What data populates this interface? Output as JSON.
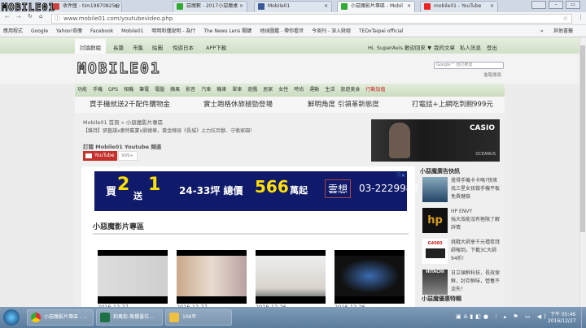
{
  "browser": {
    "tabs": [
      {
        "label": "收件匣 - tim19870825@",
        "color": "#c44"
      },
      {
        "label": "惡魔數 - 2017小惡魔桌",
        "color": "#3a3"
      },
      {
        "label": "Mobile01",
        "color": "#3b5998"
      },
      {
        "label": "小惡魔影片專區 - Mobil",
        "color": "#3a3",
        "active": true
      },
      {
        "label": "mobile01 - YouTube",
        "color": "#e22"
      }
    ],
    "url": "www.mobile01.com/youtubevideo.php",
    "bookmarks": [
      "應用程式",
      "Google",
      "Yahoo!奇摩",
      "Facebook",
      "Mobile01",
      "明明和僅說明 - 為什",
      "The News Lens 關鍵",
      "地球圖鑑 - 帶你看世",
      "今周刊 - 深入財經",
      "TEDxTaipei official",
      "»",
      "其他書籤"
    ]
  },
  "site": {
    "logo": "MOBILE01",
    "nav": [
      "討論群組",
      "長篇",
      "市集",
      "貼圖",
      "悅遊日本",
      "APP下載"
    ],
    "user": "Hi, SuperAvis 歡迎回來 ▼",
    "user_links": [
      "我的文章",
      "私人訊息",
      "登出"
    ],
    "search_placeholder": "Google™ 自訂搜尋",
    "adv_search": "進階搜尋",
    "categories": [
      "功能",
      "手機",
      "GPS",
      "相機",
      "筆電",
      "電腦",
      "蘋果",
      "影音",
      "汽車",
      "機車",
      "單車",
      "遊戲",
      "居家",
      "女性",
      "時尚",
      "運動",
      "生活",
      "旅遊美食",
      "行動加值"
    ],
    "promos": [
      "買手機就送2千配件購物金",
      "實士跑格休旅極勁登場",
      "鮮明角度 引領革新態度",
      "打電話+上網吃到飽999元"
    ],
    "breadcrumb": "Mobile01 首頁 » 小惡魔影片專區",
    "headline": "【雜詩】張藝謀x麥特戴蒙x劉德華，黃金陣容《長城》上力抗巨獸、守衛家園！",
    "subscribe_label": "訂閱 Mobile01 Youtube 頻道",
    "youtube_btn": "YouTube",
    "sub_count": "999+",
    "casio_ad": {
      "brand": "CASIO",
      "sub": "OCEANUS"
    },
    "banner_ad": {
      "t1": "買",
      "n1": "2",
      "t2": "送",
      "n2": "1",
      "size": "24-33坪 總價",
      "price": "566",
      "unit": "萬起",
      "brand": "雲想",
      "phone": "03-2229988"
    },
    "section_title": "小惡魔影片專區",
    "videos": [
      {
        "date": "2016-12-27"
      },
      {
        "date": "2016-12-27"
      },
      {
        "date": "2016-12-26"
      },
      {
        "date": "2016-12-26"
      }
    ],
    "sidebar_title": "小惡魔廣告快訊",
    "sidebar_items": [
      {
        "title": "",
        "text": "覺得手機卡卡嗎?快來找三星女孩做手機平板免費健檢"
      },
      {
        "title": "HP ENVY",
        "text": "強大效能沒有極限了解詳情"
      },
      {
        "title": "G4000",
        "text": "挑戰大師享千元禮卷拜師報到，下載3C大師94折!"
      },
      {
        "title": "HITACHI",
        "text": "日立頓鮮科技，長效保鮮，封存鮮味，營養不流失！"
      }
    ],
    "sidebar_title2": "小惡魔優惠特輯"
  },
  "taskbar": {
    "items": [
      "小惡魔影片專區 - ...",
      "和風街-衛櫻臺位...",
      "106年"
    ],
    "time": "下午 05:46",
    "date": "2016/12/27"
  }
}
